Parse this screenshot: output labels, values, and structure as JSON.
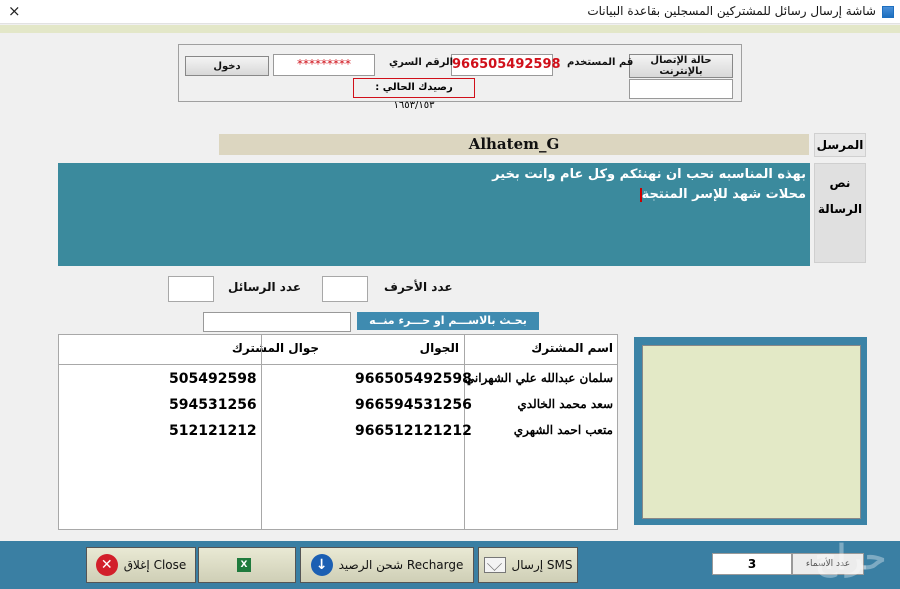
{
  "window": {
    "title": "شاشة إرسال رسائل للمشتركين المسجلين بقاعدة البيانات",
    "close_glyph": "×"
  },
  "login": {
    "connection_button": "حالة الإتصال بالإنترنت",
    "username_label": "قم المستخدم",
    "username_value": "966505492598",
    "password_label": "الرقم السري",
    "password_value": "*********",
    "login_button": "دخول",
    "balance_label": "رصيدك الحالي :",
    "balance_value": "١٦٥٣/١٥٣"
  },
  "sender": {
    "label": "المرسل",
    "value": "Alhatem_G"
  },
  "message": {
    "label": "نص الرسالة",
    "line1": "بهذه المناسبه نحب ان نهنئكم وكل عام وانت بخير",
    "line2": "محلات شهد للإسر المنتجة"
  },
  "counters": {
    "chars_label": "عدد الأحرف",
    "chars_value": "",
    "messages_label": "عدد الرسائل",
    "messages_value": ""
  },
  "search": {
    "label": "بحـث بالاســـم او حـــرء منــه",
    "value": ""
  },
  "table": {
    "headers": {
      "name": "اسم المشترك",
      "mobile": "الجوال",
      "subscriber_mobile": "جوال المشترك"
    },
    "rows": [
      {
        "name": "سلمان عبدالله علي الشهراني",
        "mobile": "966505492598",
        "short": "505492598"
      },
      {
        "name": "سعد محمد الخالدي",
        "mobile": "966594531256",
        "short": "594531256"
      },
      {
        "name": "متعب احمد الشهري",
        "mobile": "966512121212",
        "short": "512121212"
      }
    ]
  },
  "bottom": {
    "send_sms_label": "إرسال SMS",
    "recharge_label": "شحن الرصيد   Recharge",
    "excel_label": "",
    "close_label": "إغلاق  Close",
    "count_value": "3",
    "count_button": "عدد الأسماء",
    "watermark": "حراج"
  },
  "colors": {
    "teal": "#3b8a9d",
    "bar_blue": "#3a7fa3",
    "panel_green": "#e3e9c6",
    "sender_bg": "#dcd6c0",
    "alert_red": "#d21f2a"
  }
}
